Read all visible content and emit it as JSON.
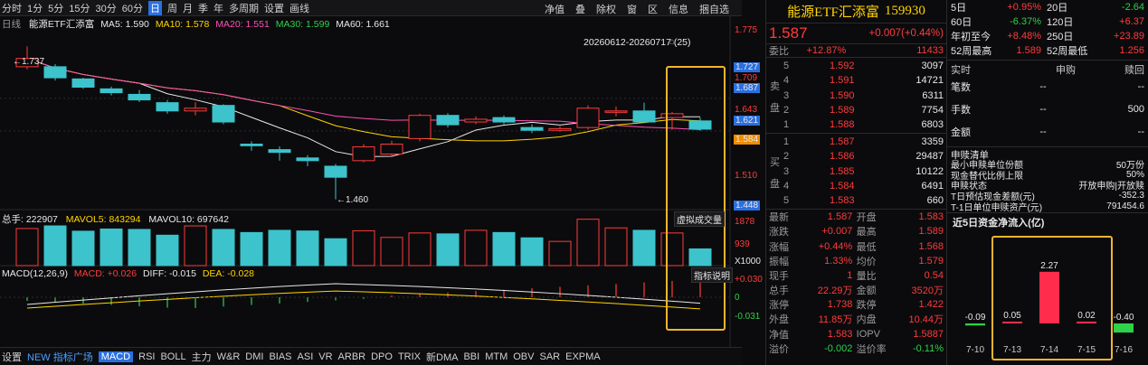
{
  "toolbar": {
    "periods": [
      "分时",
      "1分",
      "5分",
      "15分",
      "30分",
      "60分",
      "日",
      "周",
      "月",
      "季",
      "年",
      "多周期",
      "设置",
      "画线"
    ],
    "active_period": "日",
    "right_items": [
      "净值",
      "叠",
      "除权",
      "窗",
      "区",
      "信息",
      "捆自选"
    ]
  },
  "chart": {
    "info": {
      "label": "日线",
      "name": "能源ETF汇添富",
      "ma5": "MA5: 1.590",
      "ma10": "MA10: 1.578",
      "ma20": "MA20: 1.551",
      "ma30": "MA30: 1.599",
      "ma60": "MA60: 1.661"
    },
    "range_label": "20260612-20260717 (25)",
    "high_label": "1.737",
    "low_label": "1.460",
    "price_axis": [
      "1.775",
      "1.727",
      "1.709",
      "1.687",
      "1.643",
      "1.621",
      "1.584",
      "1.510",
      "1.448"
    ],
    "volume_info": {
      "label": "总手: 222907",
      "mavol5": "MAVOL5: 843294",
      "mavol10": "MAVOL10: 697642"
    },
    "volume_axis": [
      "1878",
      "939",
      "X1000"
    ],
    "virtual_volume": "虚拟成交量",
    "macd_info": {
      "label": "MACD(12,26,9)",
      "macd": "MACD: +0.026",
      "diff": "DIFF: -0.015",
      "dea": "DEA: -0.028"
    },
    "macd_axis": [
      "+0.030",
      "0",
      "-0.031"
    ],
    "indicator_btn": "指标说明"
  },
  "chart_data": {
    "type": "candlestick",
    "candles": [
      {
        "o": 1.7,
        "c": 1.715,
        "h": 1.737,
        "l": 1.695
      },
      {
        "o": 1.7,
        "c": 1.68,
        "h": 1.705,
        "l": 1.675
      },
      {
        "o": 1.678,
        "c": 1.663,
        "h": 1.68,
        "l": 1.66
      },
      {
        "o": 1.66,
        "c": 1.653,
        "h": 1.664,
        "l": 1.648
      },
      {
        "o": 1.65,
        "c": 1.64,
        "h": 1.658,
        "l": 1.636
      },
      {
        "o": 1.635,
        "c": 1.62,
        "h": 1.64,
        "l": 1.615
      },
      {
        "o": 1.62,
        "c": 1.625,
        "h": 1.636,
        "l": 1.612
      },
      {
        "o": 1.63,
        "c": 1.6,
        "h": 1.632,
        "l": 1.596
      },
      {
        "o": 1.56,
        "c": 1.557,
        "h": 1.565,
        "l": 1.548
      },
      {
        "o": 1.55,
        "c": 1.545,
        "h": 1.556,
        "l": 1.53
      },
      {
        "o": 1.535,
        "c": 1.53,
        "h": 1.54,
        "l": 1.52
      },
      {
        "o": 1.52,
        "c": 1.5,
        "h": 1.524,
        "l": 1.46
      },
      {
        "o": 1.53,
        "c": 1.555,
        "h": 1.56,
        "l": 1.527
      },
      {
        "o": 1.542,
        "c": 1.56,
        "h": 1.566,
        "l": 1.538
      },
      {
        "o": 1.57,
        "c": 1.612,
        "h": 1.615,
        "l": 1.565
      },
      {
        "o": 1.612,
        "c": 1.595,
        "h": 1.616,
        "l": 1.59
      },
      {
        "o": 1.6,
        "c": 1.605,
        "h": 1.61,
        "l": 1.596
      },
      {
        "o": 1.608,
        "c": 1.6,
        "h": 1.612,
        "l": 1.596
      },
      {
        "o": 1.59,
        "c": 1.585,
        "h": 1.596,
        "l": 1.58
      },
      {
        "o": 1.585,
        "c": 1.588,
        "h": 1.592,
        "l": 1.582
      },
      {
        "o": 1.59,
        "c": 1.625,
        "h": 1.63,
        "l": 1.586
      },
      {
        "o": 1.618,
        "c": 1.62,
        "h": 1.628,
        "l": 1.61
      },
      {
        "o": 1.62,
        "c": 1.6,
        "h": 1.635,
        "l": 1.598
      },
      {
        "o": 1.608,
        "c": 1.615,
        "h": 1.618,
        "l": 1.586
      },
      {
        "o": 1.602,
        "c": 1.587,
        "h": 1.608,
        "l": 1.584
      }
    ],
    "volumes": [
      1300,
      1420,
      1180,
      1280,
      1260,
      1000,
      1420,
      1260,
      1120,
      1220,
      1190,
      840,
      1200,
      900,
      1100,
      1060,
      1220,
      1120,
      880,
      720,
      1720,
      1330,
      1220,
      1100,
      380
    ]
  },
  "quote": {
    "name": "能源ETF汇添富",
    "code": "159930",
    "price": "1.587",
    "change": "+0.007(+0.44%)",
    "weibi_label": "委比",
    "weibi": "+12.87%",
    "weicha": "11433",
    "sell_label": "卖盘",
    "buy_label": "买盘",
    "sells": [
      {
        "lvl": "5",
        "price": "1.592",
        "vol": "3097"
      },
      {
        "lvl": "4",
        "price": "1.591",
        "vol": "14721"
      },
      {
        "lvl": "3",
        "price": "1.590",
        "vol": "6311"
      },
      {
        "lvl": "2",
        "price": "1.589",
        "vol": "7754"
      },
      {
        "lvl": "1",
        "price": "1.588",
        "vol": "6803"
      }
    ],
    "buys": [
      {
        "lvl": "1",
        "price": "1.587",
        "vol": "3359"
      },
      {
        "lvl": "2",
        "price": "1.586",
        "vol": "29487"
      },
      {
        "lvl": "3",
        "price": "1.585",
        "vol": "10122"
      },
      {
        "lvl": "4",
        "price": "1.584",
        "vol": "6491"
      },
      {
        "lvl": "5",
        "price": "1.583",
        "vol": "660"
      }
    ],
    "stats": [
      {
        "k1": "最新",
        "v1": "1.587",
        "k2": "开盘",
        "v2": "1.583"
      },
      {
        "k1": "涨跌",
        "v1": "+0.007",
        "k2": "最高",
        "v2": "1.589"
      },
      {
        "k1": "涨幅",
        "v1": "+0.44%",
        "k2": "最低",
        "v2": "1.568"
      },
      {
        "k1": "振幅",
        "v1": "1.33%",
        "k2": "均价",
        "v2": "1.579"
      },
      {
        "k1": "现手",
        "v1": "1",
        "k2": "量比",
        "v2": "0.54"
      },
      {
        "k1": "总手",
        "v1": "22.29万",
        "k2": "金额",
        "v2": "3520万"
      },
      {
        "k1": "涨停",
        "v1": "1.738",
        "k2": "跌停",
        "v2": "1.422"
      },
      {
        "k1": "外盘",
        "v1": "11.85万",
        "k2": "内盘",
        "v2": "10.44万"
      },
      {
        "k1": "净值",
        "v1": "1.583",
        "k2": "IOPV",
        "v2": "1.5887"
      },
      {
        "k1": "溢价",
        "v1": "-0.002",
        "k2": "溢价率",
        "v2": "-0.11%"
      }
    ]
  },
  "side": {
    "perf": [
      {
        "k1": "5日",
        "v1": "+0.95%",
        "k2": "20日",
        "v2": "-2.64"
      },
      {
        "k1": "60日",
        "v1": "-6.37%",
        "k2": "120日",
        "v2": "+6.37"
      },
      {
        "k1": "年初至今",
        "v1": "+8.48%",
        "k2": "250日",
        "v2": "+23.89"
      },
      {
        "k1": "52周最高",
        "v1": "1.589",
        "k2": "52周最低",
        "v2": "1.256"
      }
    ],
    "sub_header": [
      "实时",
      "申购",
      "赎回"
    ],
    "sub_rows": [
      {
        "k": "笔数",
        "a": "--",
        "b": "--"
      },
      {
        "k": "手数",
        "a": "--",
        "b": "500"
      },
      {
        "k": "金额",
        "a": "--",
        "b": "--"
      }
    ],
    "list_title": "申赎清单",
    "list_rows": [
      {
        "k": "最小申赎单位份额",
        "v": "50万份"
      },
      {
        "k": "现金替代比例上限",
        "v": "50%"
      },
      {
        "k": "申赎状态",
        "v": "开放申购|开放赎"
      },
      {
        "k": "T日预估现金差额(元)",
        "v": "-352.3"
      },
      {
        "k": "T-1日单位申赎资产(元)",
        "v": "791454.6"
      }
    ],
    "flow_title": "近5日资金净流入(亿)",
    "flow": [
      {
        "date": "7-10",
        "value": -0.09,
        "label": "-0.09"
      },
      {
        "date": "7-13",
        "value": 0.05,
        "label": "0.05"
      },
      {
        "date": "7-14",
        "value": 2.27,
        "label": "2.27"
      },
      {
        "date": "7-15",
        "value": 0.02,
        "label": "0.02"
      },
      {
        "date": "7-16",
        "value": -0.4,
        "label": "-0.40"
      }
    ]
  },
  "bottom_tabs": [
    "设置",
    "NEW 指标广场",
    "MACD",
    "RSI",
    "BOLL",
    "主力",
    "W&R",
    "DMI",
    "BIAS",
    "ASI",
    "VR",
    "ARBR",
    "DPO",
    "TRIX",
    "新DMA",
    "BBI",
    "MTM",
    "OBV",
    "SAR",
    "EXPMA"
  ],
  "active_tab": "MACD",
  "colors": {
    "up": "#ff3b3b",
    "down": "#3cc3cc",
    "accent": "#2b6fe0",
    "highlight": "#f2b431"
  }
}
